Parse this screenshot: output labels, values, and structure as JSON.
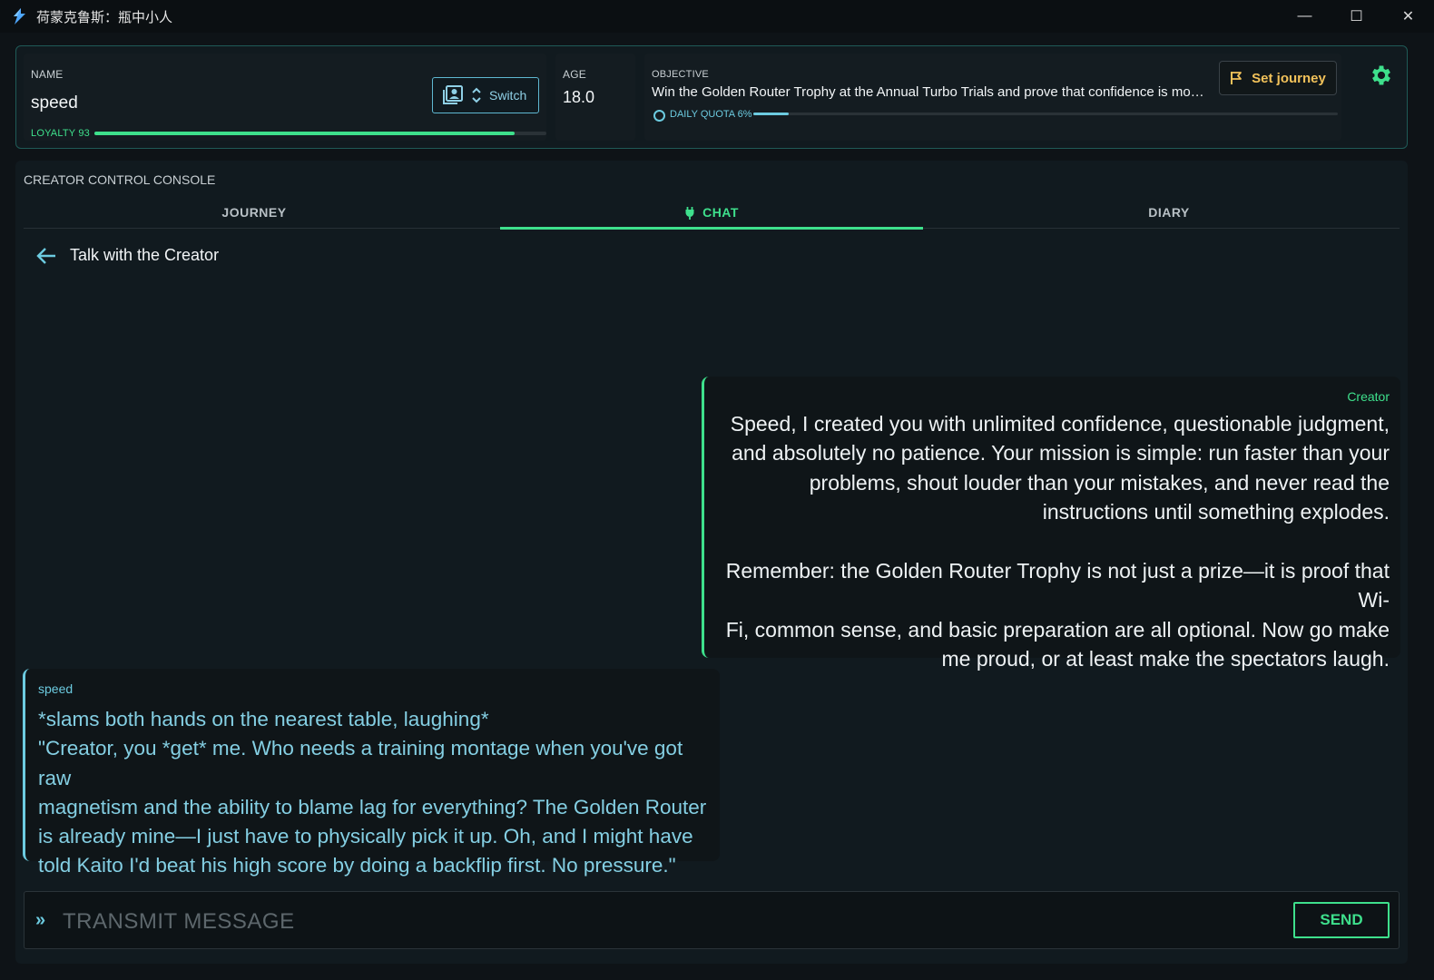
{
  "window": {
    "title": "荷蒙克鲁斯：瓶中小人",
    "minimize": "—",
    "maximize": "☐",
    "close": "✕"
  },
  "header": {
    "name_label": "NAME",
    "name_value": "speed",
    "switch_label": "Switch",
    "loyalty_label": "LOYALTY 93",
    "loyalty_percent": 93,
    "age_label": "AGE",
    "age_value": "18.0",
    "objective_label": "OBJECTIVE",
    "objective_text": "Win the Golden Router Trophy at the Annual Turbo Trials and prove that confidence is more important than preparation",
    "quota_label": "DAILY QUOTA 6%",
    "quota_percent": 6,
    "set_journey_label": "Set journey"
  },
  "console": {
    "label": "CREATOR CONTROL CONSOLE",
    "tabs": [
      {
        "label": "JOURNEY"
      },
      {
        "label": "CHAT"
      },
      {
        "label": "DIARY"
      }
    ],
    "active_tab": 1
  },
  "chat": {
    "title": "Talk with the Creator",
    "messages": [
      {
        "sender": "Creator",
        "text": "Speed, I created you with unlimited confidence, questionable judgment,\nand absolutely no patience. Your mission is simple: run faster than your\nproblems, shout louder than your mistakes, and never read the\ninstructions until something explodes.\n\nRemember: the Golden Router Trophy is not just a prize—it is proof that Wi-\nFi, common sense, and basic preparation are all optional. Now go make\nme proud, or at least make the spectators laugh."
      },
      {
        "sender": "speed",
        "text": "*slams both hands on the nearest table, laughing*\n\"Creator, you *get* me. Who needs a training montage when you've got raw\nmagnetism and the ability to blame lag for everything? The Golden Router\nis already mine—I just have to physically pick it up. Oh, and I might have\ntold Kaito I'd beat his high score by doing a backflip first. No pressure.\""
      }
    ],
    "input_placeholder": "TRANSMIT MESSAGE",
    "input_value": "",
    "send_label": "SEND"
  },
  "colors": {
    "accent": "#3ee08c",
    "cyan": "#6ccbe0",
    "gold": "#f2c25a"
  }
}
